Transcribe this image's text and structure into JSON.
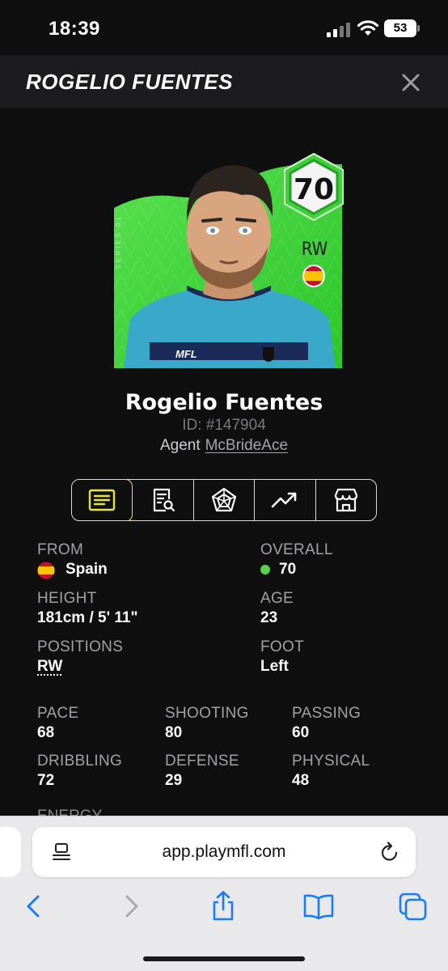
{
  "status_bar": {
    "time": "18:39",
    "battery": "53"
  },
  "header": {
    "title": "ROGELIO FUENTES"
  },
  "card": {
    "rating": "70",
    "position": "RW",
    "series": "SERIES 01",
    "club_text": "MFL"
  },
  "player": {
    "name": "Rogelio Fuentes",
    "id": "ID: #147904",
    "agent_label": "Agent",
    "agent_name": "McBrideAce"
  },
  "tabs": [
    {
      "icon": "overview-icon",
      "active": true
    },
    {
      "icon": "report-search-icon",
      "active": false
    },
    {
      "icon": "radar-icon",
      "active": false
    },
    {
      "icon": "trend-icon",
      "active": false
    },
    {
      "icon": "store-icon",
      "active": false
    }
  ],
  "info": {
    "from_label": "FROM",
    "from_value": "Spain",
    "overall_label": "OVERALL",
    "overall_value": "70",
    "height_label": "HEIGHT",
    "height_value": "181cm / 5' 11\"",
    "age_label": "AGE",
    "age_value": "23",
    "positions_label": "POSITIONS",
    "positions_value": "RW",
    "foot_label": "FOOT",
    "foot_value": "Left"
  },
  "stats": [
    {
      "label": "PACE",
      "value": "68"
    },
    {
      "label": "SHOOTING",
      "value": "80"
    },
    {
      "label": "PASSING",
      "value": "60"
    },
    {
      "label": "DRIBBLING",
      "value": "72"
    },
    {
      "label": "DEFENSE",
      "value": "29"
    },
    {
      "label": "PHYSICAL",
      "value": "48"
    }
  ],
  "energy_label": "ENERGY",
  "browser": {
    "url": "app.playmfl.com"
  },
  "colors": {
    "card_green": "#3dd13a",
    "accent_yellow": "#e8e43c",
    "overall_dot": "#59d04c",
    "ios_blue": "#1a7cf5"
  }
}
